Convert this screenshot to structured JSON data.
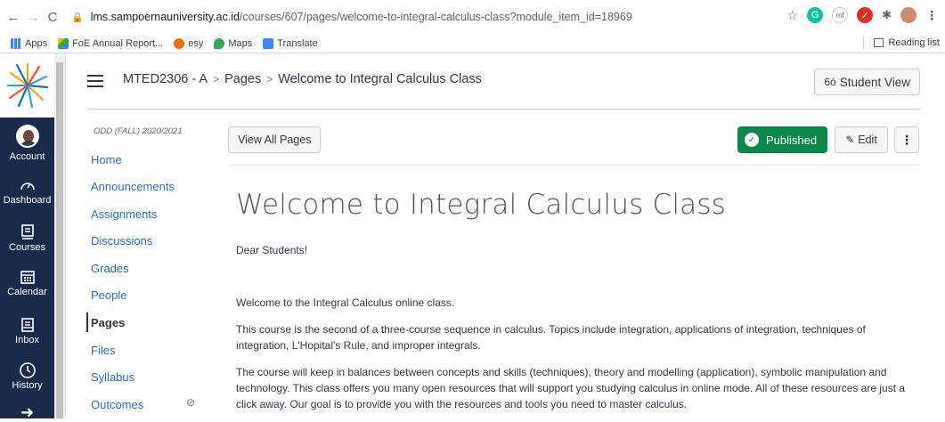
{
  "browser": {
    "url_host": "lms.sampoernauniversity.ac.id",
    "url_path": "/courses/607/pages/welcome-to-integral-calculus-class?module_item_id=18969",
    "bookmarks": [
      "Apps",
      "FoE Annual Report...",
      "esy",
      "Maps",
      "Translate"
    ],
    "reading_list": "Reading list"
  },
  "global_nav": {
    "items": [
      "Account",
      "Dashboard",
      "Courses",
      "Calendar",
      "Inbox",
      "History"
    ]
  },
  "header": {
    "crumbs": [
      "MTED2306 - A",
      "Pages",
      "Welcome to Integral Calculus Class"
    ],
    "student_view": "Student View"
  },
  "course_nav": {
    "term": "ODD (FALL) 2020/2021",
    "items": [
      "Home",
      "Announcements",
      "Assignments",
      "Discussions",
      "Grades",
      "People",
      "Pages",
      "Files",
      "Syllabus",
      "Outcomes"
    ],
    "active": "Pages"
  },
  "toolbar": {
    "view_all": "View All Pages",
    "published": "Published",
    "edit": "Edit"
  },
  "page": {
    "title": "Welcome to Integral Calculus Class",
    "greeting": "Dear Students!",
    "p1": "Welcome to the Integral Calculus online class.",
    "p2": "This course is the second of a three-course sequence in calculus. Topics include integration, applications of integration, techniques of integration, L'Hopital's Rule, and improper integrals.",
    "p3": "The course will keep in balances between concepts and skills (techniques), theory and modelling (application), symbolic manipulation and technology. This class offers you many open resources that will support you studying calculus in online mode. All of these resources are just a click away. Our goal is to provide you with the resources and tools you need to master calculus."
  }
}
